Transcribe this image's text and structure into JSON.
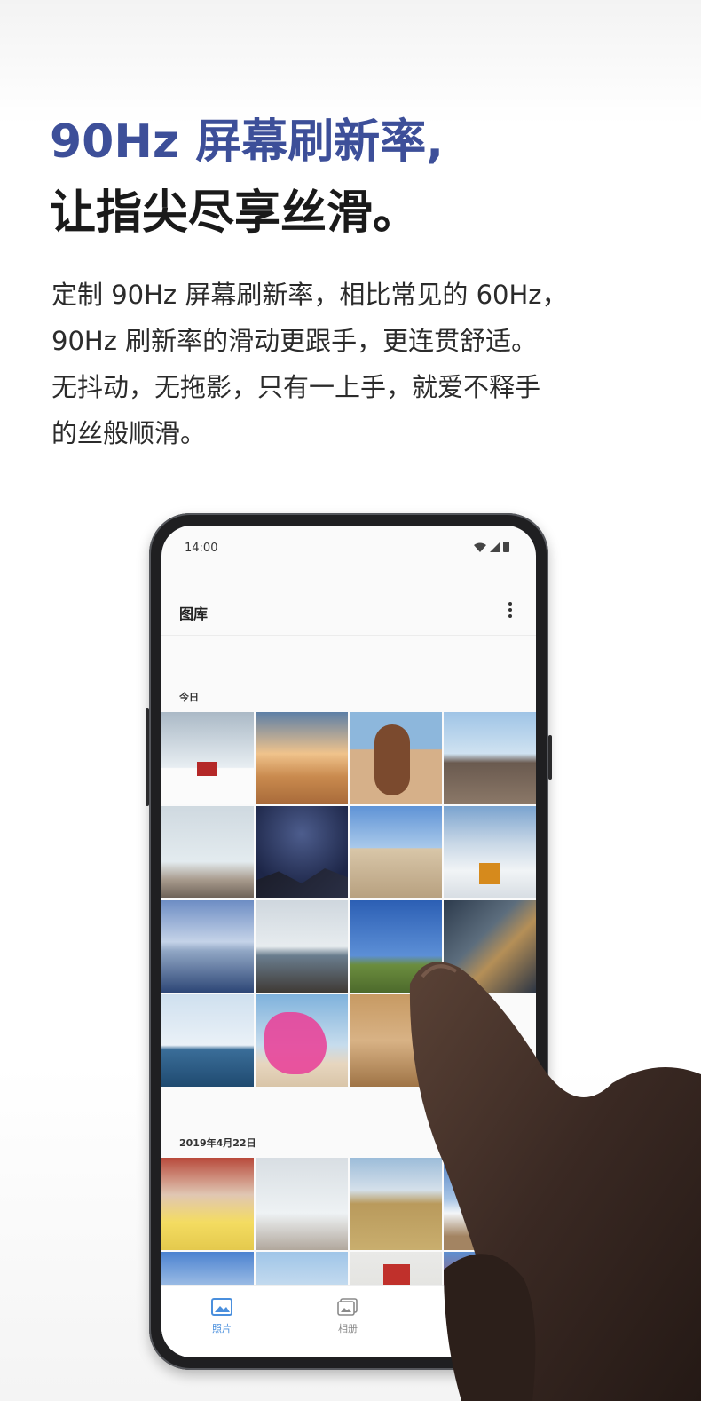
{
  "headline": {
    "line1": "90Hz 屏幕刷新率,",
    "line2": "让指尖尽享丝滑。"
  },
  "body_lines": [
    "定制 90Hz 屏幕刷新率，相比常见的 60Hz，",
    "90Hz 刷新率的滑动更跟手，更连贯舒适。",
    "无抖动，无拖影，只有一上手，就爱不释手",
    "的丝般顺滑。"
  ],
  "colors": {
    "headline_accent": "#3d4f99",
    "nav_active": "#4a8fdd"
  },
  "phone": {
    "status": {
      "time": "14:00",
      "icons": [
        "wifi-icon",
        "signal-icon",
        "battery-icon"
      ]
    },
    "app_bar": {
      "title": "图库",
      "menu_icon": "more-vertical-icon"
    },
    "sections": [
      {
        "label": "今日"
      },
      {
        "label": "2019年4月22日"
      }
    ],
    "bottom_nav": [
      {
        "label": "照片",
        "icon": "photo-icon",
        "active": true
      },
      {
        "label": "相册",
        "icon": "album-icon",
        "active": false
      }
    ]
  }
}
